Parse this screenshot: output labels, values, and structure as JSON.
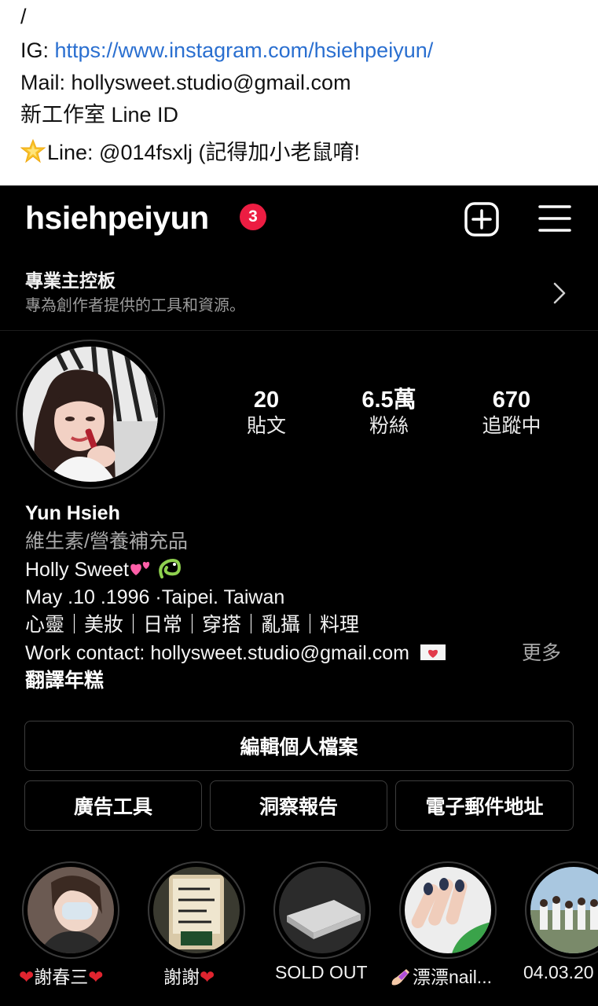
{
  "post": {
    "slash": "/",
    "ig_label": "IG: ",
    "ig_link": "https://www.instagram.com/hsiehpeiyun/",
    "mail": "Mail: hollysweet.studio@gmail.com",
    "studio_line": "新工作室 Line ID",
    "line_text": "Line: @014fsxlj  (記得加小老鼠唷!"
  },
  "profile": {
    "username": "hsiehpeiyun",
    "notif_count": "3",
    "pro_title": "專業主控板",
    "pro_sub": "專為創作者提供的工具和資源。",
    "stats": [
      {
        "num": "20",
        "label": "貼文"
      },
      {
        "num": "6.5萬",
        "label": "粉絲"
      },
      {
        "num": "670",
        "label": "追蹤中"
      }
    ],
    "name": "Yun Hsieh",
    "category": "維生素/營養補充品",
    "bio1": "Holly Sweet",
    "bio2": "May .10 .1996 ·Taipei. Taiwan",
    "bio3": "心靈｜美妝｜日常｜穿搭｜亂攝｜料理",
    "bio4": "Work contact: hollysweet.studio@gmail.com",
    "more": "更多",
    "translate": "翻譯年糕"
  },
  "buttons": {
    "edit": "編輯個人檔案",
    "ads": "廣告工具",
    "insights": "洞察報告",
    "email": "電子郵件地址"
  },
  "highlights": [
    {
      "label": "謝春三"
    },
    {
      "label": "謝謝"
    },
    {
      "label": "SOLD OUT"
    },
    {
      "label": "漂漂nail..."
    },
    {
      "label": "04.03.20"
    }
  ],
  "colors": {
    "link": "#2a6fd0",
    "notif_badge": "#ec1d42",
    "background": "#000000"
  }
}
